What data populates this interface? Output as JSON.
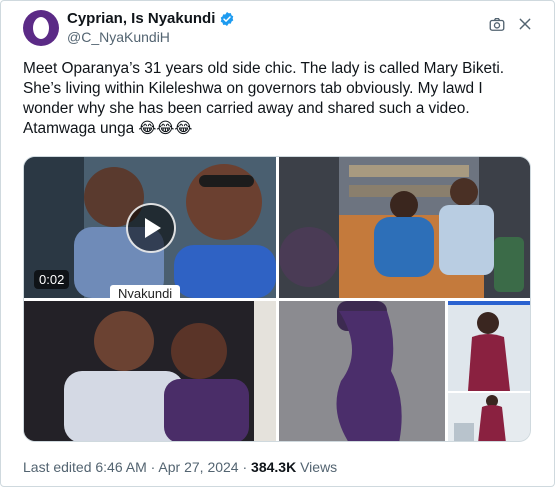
{
  "author": {
    "display_name": "Cyprian, Is Nyakundi",
    "handle": "@C_NyaKundiH",
    "verified": true,
    "avatar_color": "#5b2a86"
  },
  "tweet": {
    "lines": [
      "Meet Oparanya’s 31 years old side chic. The lady is called Mary Biketi.",
      "She’s living within Kileleshwa on governors tab obviously. My lawd I",
      "wonder why she has been carried away and shared such a video.",
      "Atamwaga unga 😂😂😂"
    ]
  },
  "media": {
    "video": {
      "duration": "0:02",
      "watermark": "Nyakundi"
    },
    "photo_count": 5
  },
  "footer": {
    "edited_label": "Last edited 6:46 AM · Apr 27, 2024 · ",
    "views_count": "384.3K",
    "views_label": " Views"
  },
  "icons": {
    "verified": "verified-badge-icon",
    "camera": "camera-icon",
    "close": "close-icon"
  },
  "colors": {
    "verified_blue": "#1d9bf0",
    "secondary_text": "#536471",
    "primary_text": "#0f1419"
  }
}
